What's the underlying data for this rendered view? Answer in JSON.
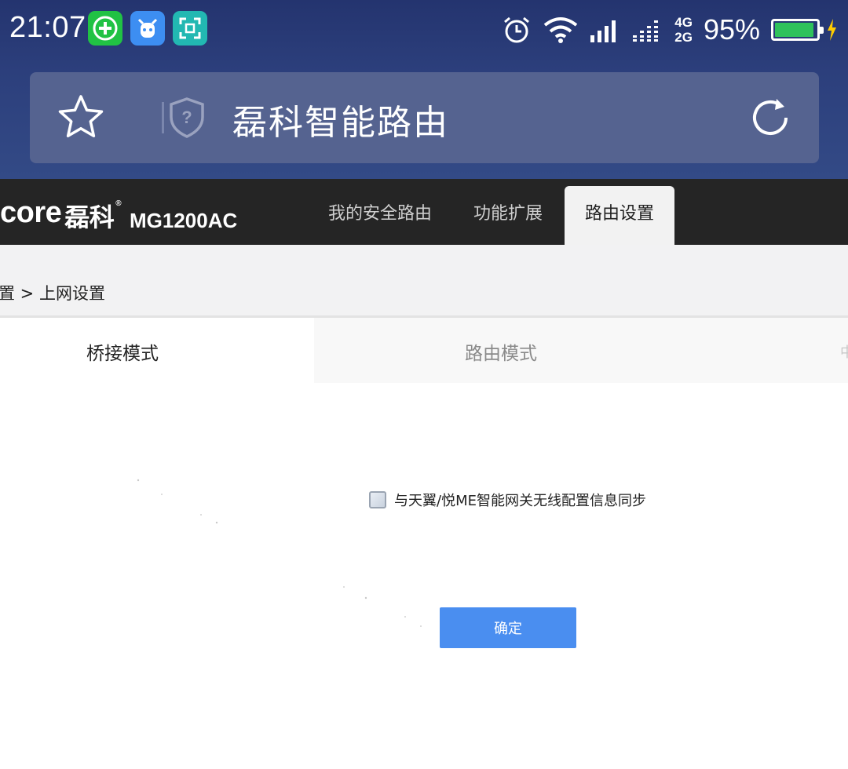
{
  "status_bar": {
    "time": "21:07",
    "apps": [
      "add-circle-app-icon",
      "cow-app-icon",
      "scan-app-icon"
    ],
    "network_top": "4G",
    "network_bottom": "2G",
    "battery_percent": "95%",
    "battery_level": 0.95
  },
  "browser": {
    "page_title": "磊科智能路由"
  },
  "router": {
    "brand_latin": "core",
    "brand_cn": "磊科",
    "brand_mark": "®",
    "model": "MG1200AC",
    "nav": [
      {
        "label": "我的安全路由",
        "active": false
      },
      {
        "label": "功能扩展",
        "active": false
      },
      {
        "label": "路由设置",
        "active": true
      }
    ],
    "breadcrumb": "置 > 上网设置",
    "modes": [
      {
        "label": "桥接模式",
        "active": true
      },
      {
        "label": "路由模式",
        "active": false
      }
    ],
    "mode_overflow": "中",
    "sync_label": "与天翼/悦ME智能网关无线配置信息同步",
    "sync_checked": false,
    "confirm_label": "确定"
  },
  "colors": {
    "chrome": "#2c3f7c",
    "header": "#252525",
    "button": "#4a8ef0"
  }
}
